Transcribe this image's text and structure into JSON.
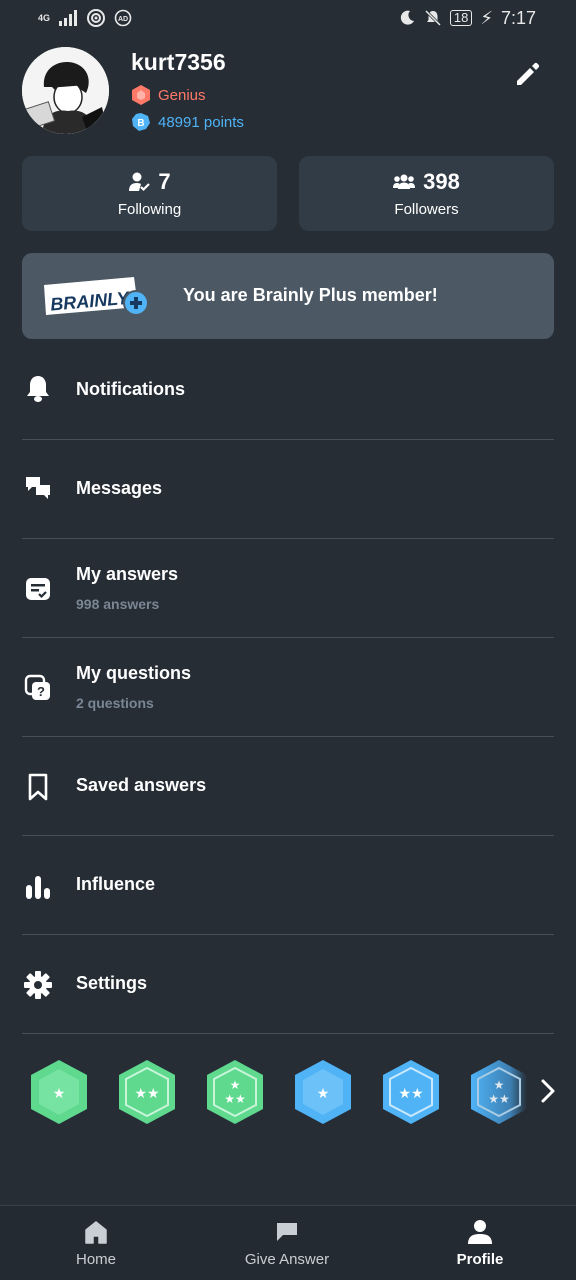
{
  "status_bar": {
    "network": "4G",
    "time": "7:17",
    "battery": "18"
  },
  "profile": {
    "username": "kurt7356",
    "rank": "Genius",
    "points": "48991 points"
  },
  "stats": {
    "following_count": "7",
    "following_label": "Following",
    "followers_count": "398",
    "followers_label": "Followers"
  },
  "plus_banner": {
    "logo_text": "BRAINLY",
    "message": "You are Brainly Plus member!"
  },
  "menu": {
    "notifications": {
      "label": "Notifications"
    },
    "messages": {
      "label": "Messages"
    },
    "my_answers": {
      "label": "My answers",
      "sub": "998 answers"
    },
    "my_questions": {
      "label": "My questions",
      "sub": "2 questions"
    },
    "saved_answers": {
      "label": "Saved answers"
    },
    "influence": {
      "label": "Influence"
    },
    "settings": {
      "label": "Settings"
    }
  },
  "badges": {
    "items": [
      {
        "name": "green-1-star",
        "color": "#5fd98e",
        "stars": 1
      },
      {
        "name": "green-2-star",
        "color": "#5fd98e",
        "stars": 2
      },
      {
        "name": "green-3-star",
        "color": "#5fd98e",
        "stars": 3
      },
      {
        "name": "blue-1-star",
        "color": "#4fb3f6",
        "stars": 1
      },
      {
        "name": "blue-2-star",
        "color": "#4fb3f6",
        "stars": 2
      },
      {
        "name": "blue-3-star",
        "color": "#4fb3f6",
        "stars": 3
      }
    ]
  },
  "bottom_nav": {
    "home": "Home",
    "give_answer": "Give Answer",
    "profile": "Profile"
  },
  "colors": {
    "background": "#262d35",
    "card": "#323c46",
    "banner": "#4c5965",
    "rank": "#ff7968",
    "points": "#4fb3f6"
  }
}
